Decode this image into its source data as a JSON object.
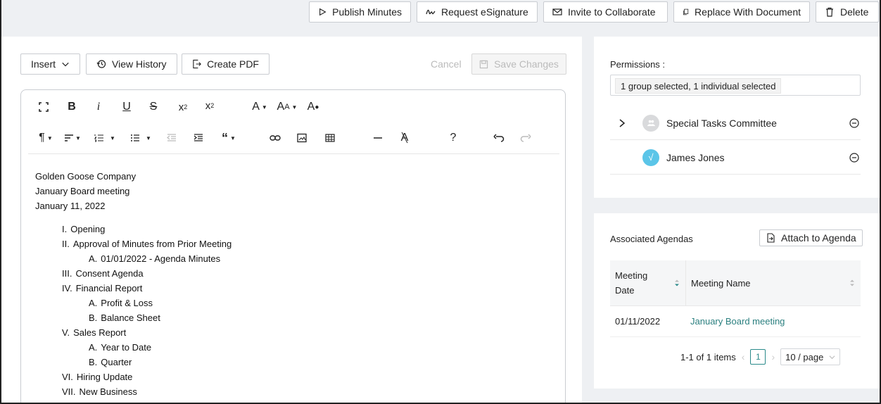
{
  "toolbar": {
    "publish": "Publish Minutes",
    "esign": "Request eSignature",
    "invite": "Invite to Collaborate",
    "replace": "Replace With Document",
    "delete": "Delete"
  },
  "editor_actions": {
    "insert": "Insert",
    "history": "View History",
    "pdf": "Create PDF",
    "cancel": "Cancel",
    "save": "Save Changes"
  },
  "format_toolbar": {
    "row1": [
      "fullscreen-icon",
      "bold-icon",
      "italic-icon",
      "underline-icon",
      "strikethrough-icon",
      "subscript-icon",
      "superscript-icon",
      "font-color-icon",
      "font-size-icon",
      "clear-format-icon"
    ],
    "row2": [
      "paragraph-icon",
      "align-icon",
      "ordered-list-icon",
      "unordered-list-icon",
      "outdent-icon",
      "indent-icon",
      "quote-icon",
      "link-icon",
      "image-icon",
      "table-icon",
      "hr-icon",
      "clear-formatting-icon",
      "help-icon",
      "undo-icon",
      "redo-icon"
    ],
    "help_label": "?"
  },
  "document": {
    "company": "Golden Goose Company",
    "meeting": "January Board meeting",
    "date": "January 11, 2022",
    "items": [
      {
        "n": "I.",
        "t": "Opening",
        "level": 1
      },
      {
        "n": "II.",
        "t": "Approval of Minutes from Prior Meeting",
        "level": 1
      },
      {
        "n": "A.",
        "t": "01/01/2022 - Agenda Minutes",
        "level": 2
      },
      {
        "n": "III.",
        "t": "Consent Agenda",
        "level": 1
      },
      {
        "n": "IV.",
        "t": "Financial Report",
        "level": 1
      },
      {
        "n": "A.",
        "t": "Profit & Loss",
        "level": 2
      },
      {
        "n": "B.",
        "t": "Balance Sheet",
        "level": 2
      },
      {
        "n": "V.",
        "t": "Sales Report",
        "level": 1
      },
      {
        "n": "A.",
        "t": "Year to Date",
        "level": 2
      },
      {
        "n": "B.",
        "t": "Quarter",
        "level": 2
      },
      {
        "n": "VI.",
        "t": "Hiring Update",
        "level": 1
      },
      {
        "n": "VII.",
        "t": "New Business",
        "level": 1
      }
    ]
  },
  "permissions": {
    "label": "Permissions :",
    "summary": "1 group selected, 1 individual selected",
    "entries": [
      {
        "name": "Special Tasks Committee",
        "type": "group",
        "avatar_color": "#d9dadc"
      },
      {
        "name": "James Jones",
        "type": "individual",
        "avatar_color": "#5bc5e8"
      }
    ]
  },
  "agendas": {
    "title": "Associated Agendas",
    "attach": "Attach to Agenda",
    "columns": [
      "Meeting Date",
      "Meeting Name"
    ],
    "rows": [
      {
        "date": "01/11/2022",
        "name": "January Board meeting"
      }
    ],
    "pager_text": "1-1 of 1 items",
    "page": "1",
    "page_size": "10 / page"
  },
  "colors": {
    "link": "#2a7f7f",
    "accent": "#2a8a8a"
  }
}
